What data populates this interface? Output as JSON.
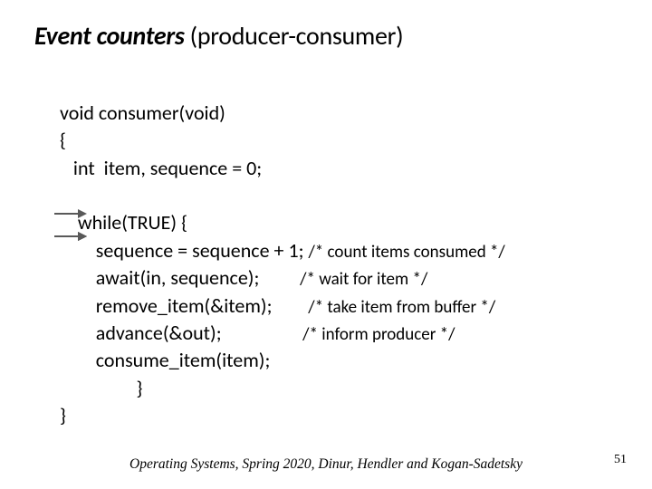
{
  "title": {
    "bold_italic": "Event counters",
    "plain": " (producer-consumer)"
  },
  "code": {
    "l1": "void consumer(void)",
    "l2": "{",
    "l3": "   int  item, sequence = 0;",
    "l4": "",
    "l5": "    while(TRUE) {",
    "l6a": "        sequence = sequence + 1; ",
    "l6c": "/* count items consumed */",
    "l7a": "        await(in, sequence);         ",
    "l7c": "/* wait for item */",
    "l8a": "        remove_item(&item);        ",
    "l8c": "/* take item from buffer */",
    "l9a": "        advance(&out);                  ",
    "l9c": "/* inform producer */",
    "l10": "        consume_item(item);",
    "l11": "                 }",
    "l12": "}"
  },
  "footer": "Operating Systems,  Spring 2020,  Dinur,  Hendler and Kogan-Sadetsky",
  "pagenum": "51"
}
